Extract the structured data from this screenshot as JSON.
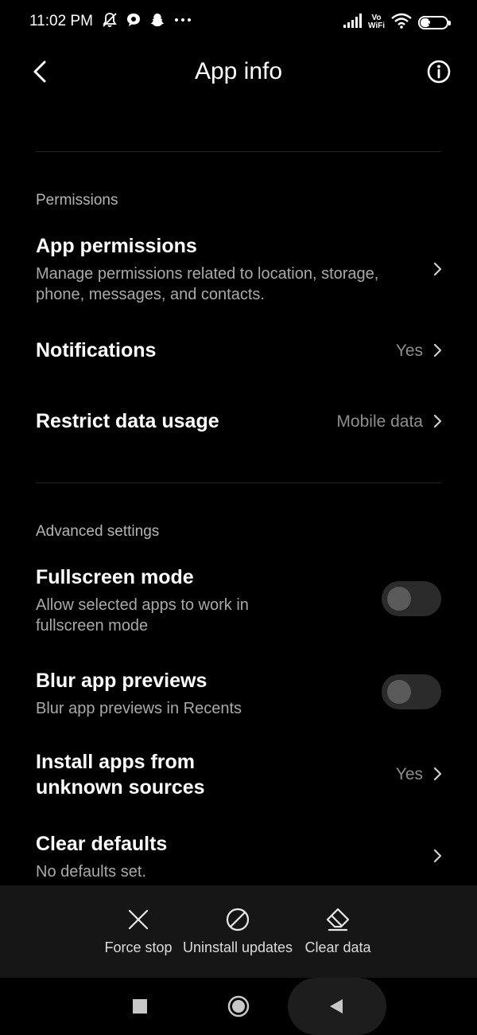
{
  "status_bar": {
    "time": "11:02 PM",
    "battery": "35",
    "battery_level": 0.35,
    "left_icons": [
      "bell-off-icon",
      "chat-icon",
      "snapchat-icon",
      "more-dots-icon"
    ],
    "right_icons": [
      "signal-icon",
      "vowifi-icon",
      "wifi-icon",
      "battery-icon"
    ],
    "vowifi_top": "Vo",
    "vowifi_bottom": "WiFi"
  },
  "header": {
    "title": "App info",
    "back_icon": "chevron-left-icon",
    "info_icon": "info-circle-icon"
  },
  "permissions": {
    "section_label": "Permissions",
    "app_permissions": {
      "title": "App permissions",
      "subtitle_line1": "Manage permissions related to location, storage,",
      "subtitle_line2": "phone, messages, and contacts."
    },
    "notifications": {
      "title": "Notifications",
      "value": "Yes"
    },
    "restrict_data": {
      "title": "Restrict data usage",
      "value": "Mobile data"
    }
  },
  "advanced": {
    "section_label": "Advanced settings",
    "fullscreen": {
      "title": "Fullscreen mode",
      "subtitle_line1": "Allow selected apps to work in",
      "subtitle_line2": "fullscreen mode",
      "enabled": false
    },
    "blur": {
      "title": "Blur app previews",
      "subtitle": "Blur app previews in Recents",
      "enabled": false
    },
    "unknown_sources": {
      "title_line1": "Install apps from",
      "title_line2": "unknown sources",
      "value": "Yes"
    },
    "clear_defaults": {
      "title": "Clear defaults",
      "subtitle": "No defaults set."
    }
  },
  "actions": {
    "force_stop": "Force stop",
    "uninstall_updates": "Uninstall updates",
    "clear_data": "Clear data"
  },
  "colors": {
    "background": "#000000",
    "text_primary": "#ffffff",
    "text_secondary": "#a9a9a9",
    "action_bar": "#161616"
  }
}
